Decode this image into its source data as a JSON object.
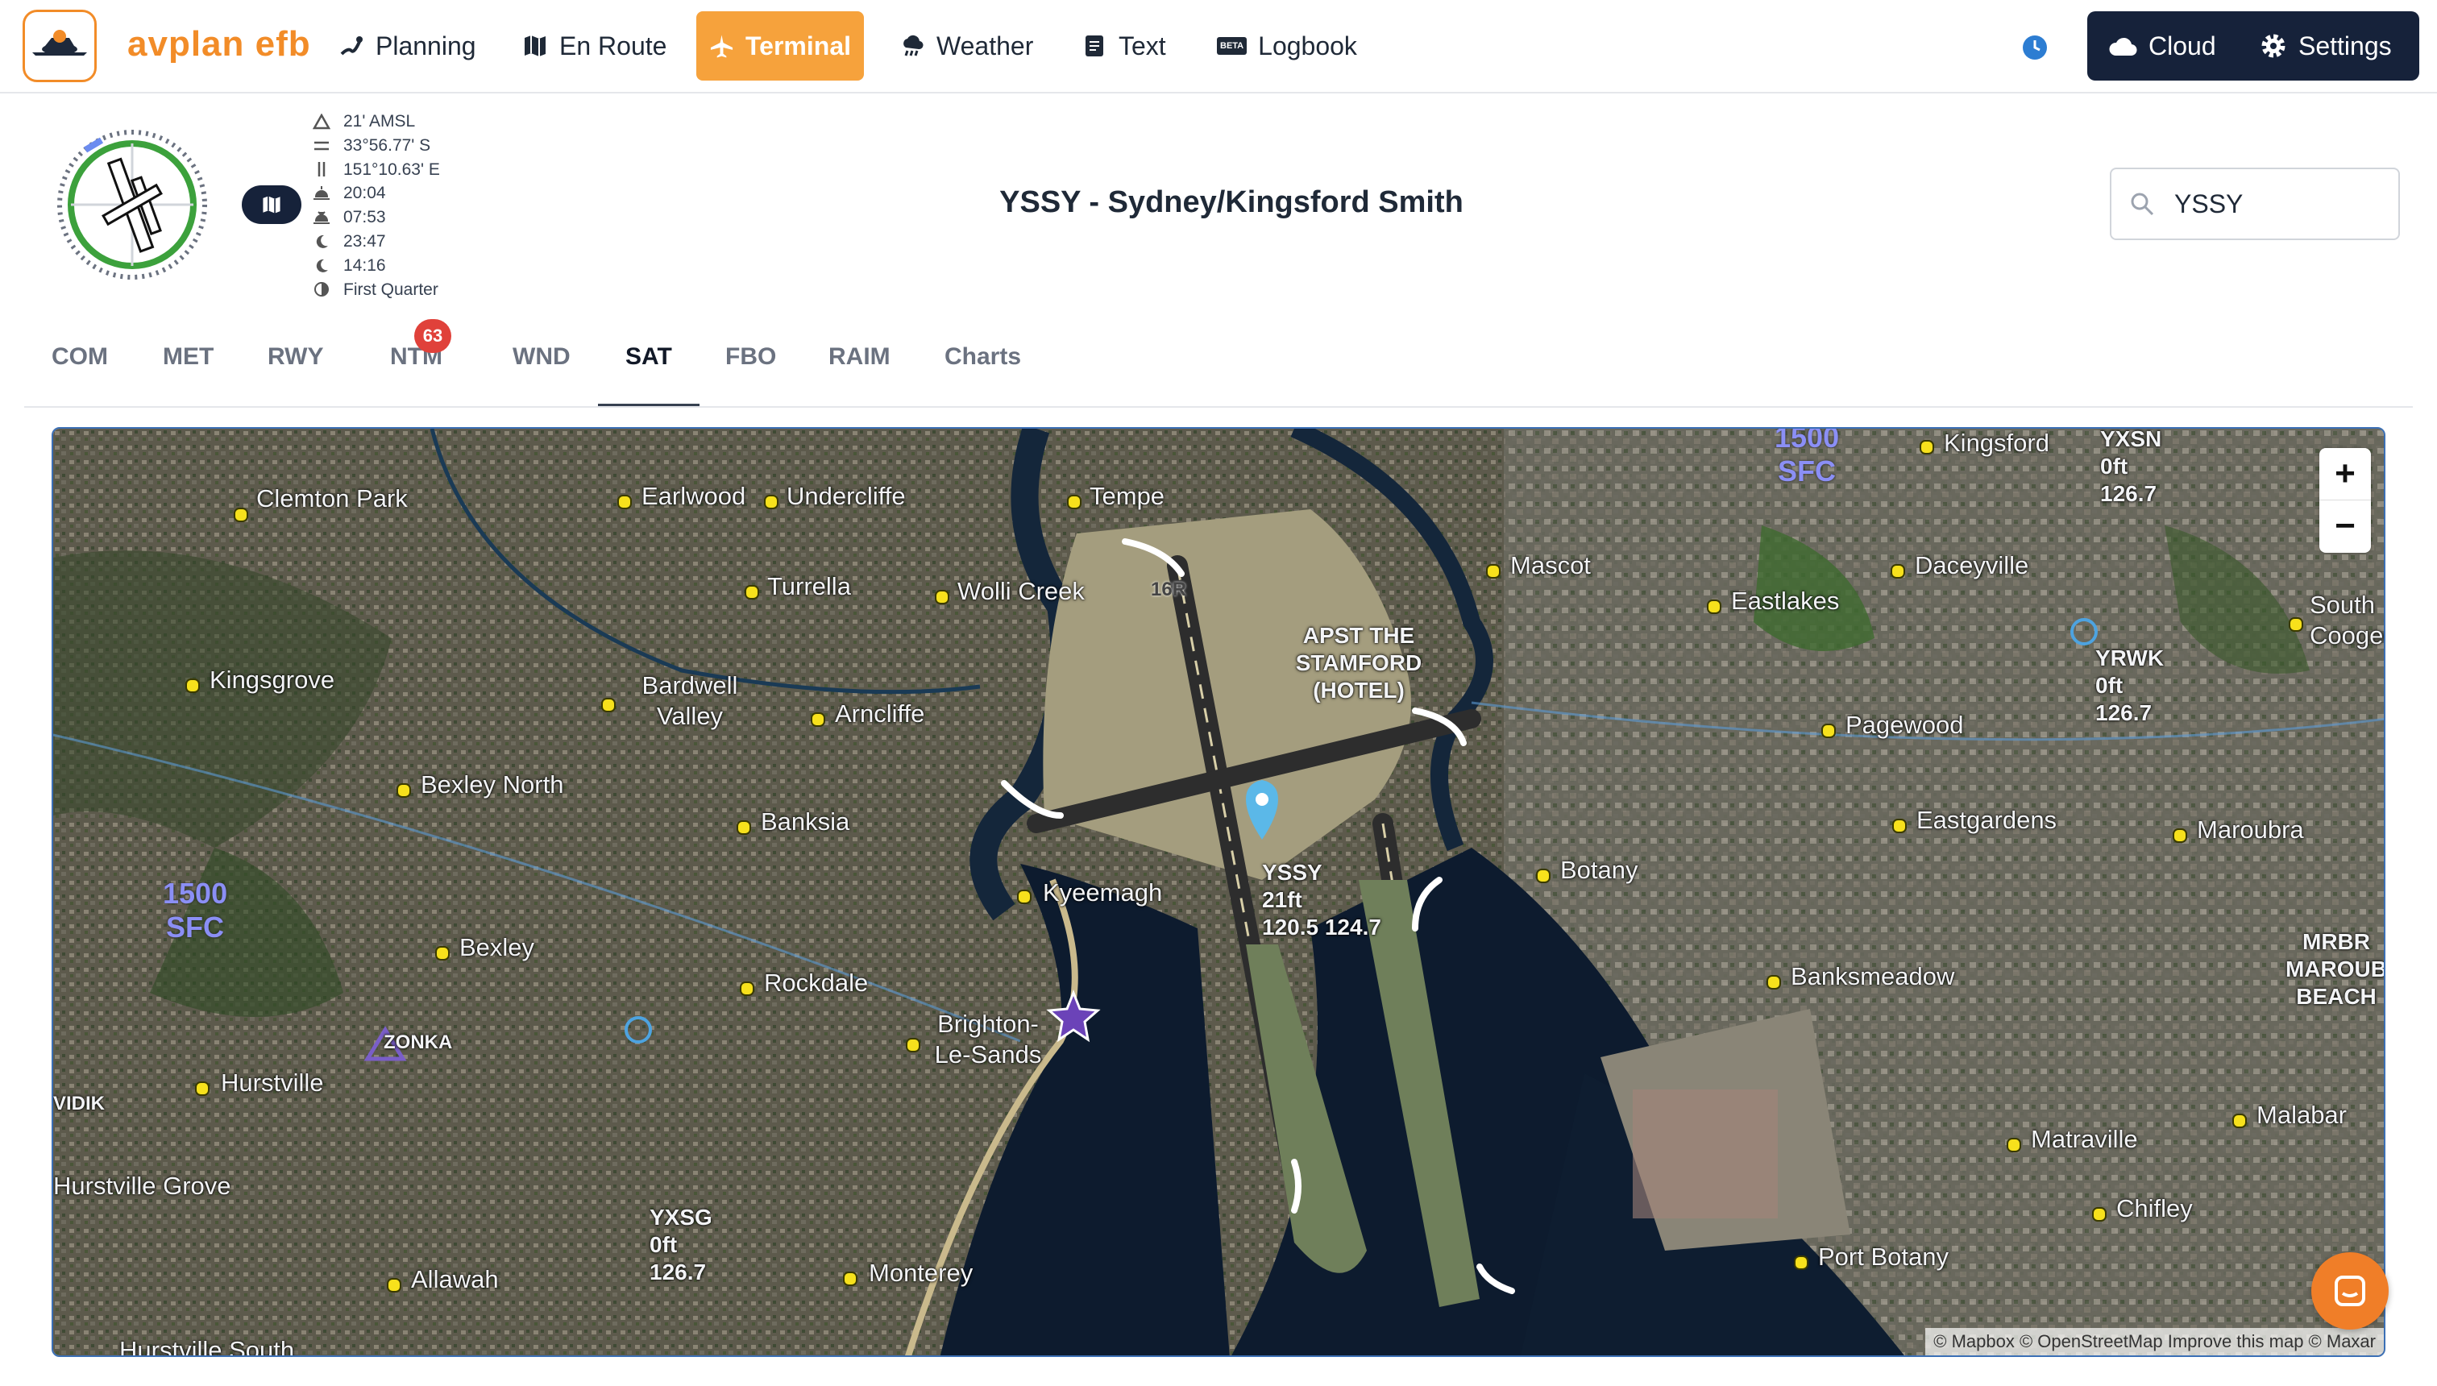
{
  "brand": {
    "part1": "avplan",
    "part2": "efb"
  },
  "nav": [
    {
      "label": "Planning",
      "icon": "route-icon"
    },
    {
      "label": "En Route",
      "icon": "map-icon"
    },
    {
      "label": "Terminal",
      "icon": "plane-icon"
    },
    {
      "label": "Weather",
      "icon": "cloud-rain-icon"
    },
    {
      "label": "Text",
      "icon": "document-icon"
    },
    {
      "label": "Logbook",
      "icon": "beta-icon"
    }
  ],
  "beta_label": "BETA",
  "cloud_label": "Cloud",
  "settings_label": "Settings",
  "airport_info": [
    {
      "icon": "elevation-icon",
      "text": "21' AMSL"
    },
    {
      "icon": "latitude-icon",
      "text": "33°56.77' S"
    },
    {
      "icon": "longitude-icon",
      "text": "151°10.63' E"
    },
    {
      "icon": "sunrise-icon",
      "text": "20:04"
    },
    {
      "icon": "sunset-icon",
      "text": "07:53"
    },
    {
      "icon": "moonrise-icon",
      "text": "23:47"
    },
    {
      "icon": "moonset-icon",
      "text": "14:16"
    },
    {
      "icon": "moon-phase-icon",
      "text": "First Quarter"
    }
  ],
  "title": "YSSY - Sydney/Kingsford Smith",
  "search": {
    "value": "YSSY",
    "placeholder": ""
  },
  "tabs": [
    "COM",
    "MET",
    "RWY",
    "NTM",
    "WND",
    "SAT",
    "FBO",
    "RAIM",
    "Charts"
  ],
  "active_tab": "SAT",
  "ntm_badge": "63",
  "map": {
    "suburbs": [
      "Clemton Park",
      "Earlwood",
      "Undercliffe",
      "Tempe",
      "Turrella",
      "Wolli Creek",
      "Kingsgrove",
      "Bardwell Valley",
      "Arncliffe",
      "Bexley North",
      "Banksia",
      "Kyeemagh",
      "Bexley",
      "Rockdale",
      "Brighton-Le-Sands",
      "Hurstville",
      "Allawah",
      "Monterey",
      "Hurstville South",
      "Kingsford",
      "Mascot",
      "Daceyville",
      "Eastlakes",
      "Pagewood",
      "Eastgardens",
      "Botany",
      "Maroubra",
      "Banksmeadow",
      "Matraville",
      "Malabar",
      "Chifley",
      "Port Botany",
      "South Coogee",
      "Hurstville Grove"
    ],
    "airport_label": {
      "code": "YSSY",
      "elev": "21ft",
      "freq": "120.5 124.7"
    },
    "apst": "APST THE STAMFORD (HOTEL)",
    "heli": [
      {
        "code": "YXSN",
        "elev": "0ft",
        "freq": "126.7"
      },
      {
        "code": "YRWK",
        "elev": "0ft",
        "freq": "126.7"
      },
      {
        "code": "YXSG",
        "elev": "0ft",
        "freq": "126.7"
      }
    ],
    "airspace": [
      {
        "top": "1500",
        "bottom": "SFC"
      },
      {
        "top": "1500",
        "bottom": "SFC"
      }
    ],
    "waypoints": [
      "ZONKA",
      "VIDIK"
    ],
    "mrbr": "MRBR MAROUBRA BEACH",
    "runway_marker": "16R",
    "zoom_in": "+",
    "zoom_out": "−",
    "attribution": "© Mapbox © OpenStreetMap  Improve this map © Maxar"
  },
  "colors": {
    "accent": "#f6a23c",
    "dark": "#16223a",
    "badge": "#e0413a"
  }
}
